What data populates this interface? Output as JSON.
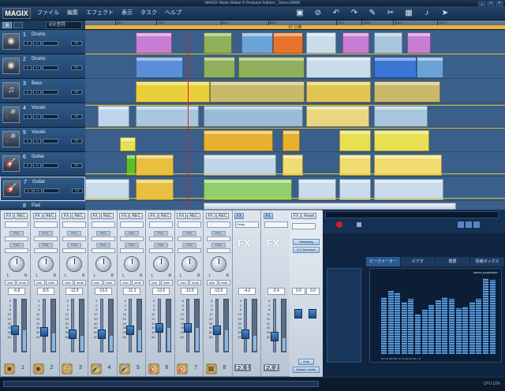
{
  "window": {
    "title": "MAGIX Music Maker 5 Producer Edition    _Demo.MMM"
  },
  "logo": "MAGIX",
  "menu": [
    "ファイル",
    "編集",
    "エフェクト",
    "表示",
    "タスク",
    "ヘルプ"
  ],
  "toolbar_icons": [
    "save-icon",
    "fx-icon",
    "undo-icon",
    "redo-icon",
    "draw-icon",
    "scissors-icon",
    "glue-icon",
    "note-icon",
    "pointer-icon"
  ],
  "snap": "8分音符",
  "range_label": "97 小節",
  "ruler_ticks": [
    "65:1",
    "73:1",
    "81:1",
    "89:1",
    "97:1",
    "105:1",
    "113:1",
    "121:1"
  ],
  "tracks": [
    {
      "num": "1",
      "name": "Drums",
      "icon": "drum-icon",
      "color": "#c45fbf"
    },
    {
      "num": "2",
      "name": "Drums",
      "icon": "drum-icon",
      "color": "#3d77d6"
    },
    {
      "num": "3",
      "name": "Bass",
      "icon": "bass-icon",
      "color": "#d8c338"
    },
    {
      "num": "4",
      "name": "Vocals",
      "icon": "vocals-icon",
      "color": "#a9c6df"
    },
    {
      "num": "5",
      "name": "Vocals",
      "icon": "vocals-icon",
      "color": "#e8e050"
    },
    {
      "num": "6",
      "name": "Guitar",
      "icon": "guitar-icon",
      "color": "#e8c040"
    },
    {
      "num": "7",
      "name": "Guitar",
      "icon": "guitar-icon",
      "color": "#b8d8ee"
    },
    {
      "num": "8",
      "name": "Pad",
      "icon": "pad-icon",
      "color": "#c8d8e8"
    }
  ],
  "mixer": {
    "strips": [
      {
        "fx": "FX",
        "rec": "REC",
        "fx1": "FX1",
        "fx2": "FX2",
        "solo": "solo",
        "mute": "mute",
        "volume": "-6.8",
        "num": "1",
        "level": 0.4
      },
      {
        "fx": "FX",
        "rec": "REC",
        "fx1": "FX1",
        "fx2": "FX2",
        "solo": "solo",
        "mute": "mute",
        "volume": "-8.5",
        "num": "2",
        "level": 0.35
      },
      {
        "fx": "FX",
        "rec": "REC",
        "fx1": "FX1",
        "fx2": "FX2",
        "solo": "solo",
        "mute": "mute",
        "volume": "-12.9",
        "num": "3",
        "level": 0.3
      },
      {
        "fx": "FX",
        "rec": "REC",
        "fx1": "FX1",
        "fx2": "FX2",
        "solo": "solo",
        "mute": "mute",
        "volume": "-13.6",
        "num": "4",
        "level": 0.3
      },
      {
        "fx": "FX",
        "rec": "REC",
        "fx1": "FX1",
        "fx2": "FX2",
        "solo": "solo",
        "mute": "mute",
        "volume": "-11.1",
        "num": "5",
        "level": 0.4
      },
      {
        "fx": "FX",
        "rec": "REC",
        "fx1": "FX1",
        "fx2": "FX2",
        "solo": "solo",
        "mute": "mute",
        "volume": "-13.6",
        "num": "6",
        "level": 0.45
      },
      {
        "fx": "FX",
        "rec": "REC",
        "fx1": "FX1",
        "fx2": "FX2",
        "solo": "solo",
        "mute": "mute",
        "volume": "-13.9",
        "num": "7",
        "level": 0.45
      },
      {
        "fx": "FX",
        "rec": "REC",
        "fx1": "FX1",
        "fx2": "FX2",
        "solo": "solo",
        "mute": "mute",
        "volume": "-13.9",
        "num": "8",
        "level": 0.4
      }
    ],
    "fx_returns": [
      {
        "label": "FX",
        "dd": "Delay",
        "volume": "-4.2",
        "num": "1",
        "level": 0.3
      },
      {
        "label": "FX",
        "dd": "",
        "volume": "-2.4",
        "num": "2",
        "level": 0.25
      }
    ],
    "master": {
      "fx": "FX",
      "reset": "Reset",
      "mastering": "Mastering",
      "surround": "5.1 Surround",
      "left": "0.0",
      "right": "0.0",
      "link": "Link",
      "limiter": "Master Limiter"
    },
    "scale": [
      "6",
      "0",
      "6",
      "10",
      "20",
      "30",
      "40",
      "50",
      "60"
    ]
  },
  "tabs": [
    "ピークメーター",
    "ビデオ",
    "概要",
    "情報ボックス"
  ],
  "peakmeter": {
    "title": "stereo peakmeter",
    "freqs": "60 120 250 500 1K 2K 4K 8K 16K L R",
    "levels": [
      0.72,
      0.8,
      0.78,
      0.66,
      0.7,
      0.5,
      0.56,
      0.62,
      0.68,
      0.72,
      0.7,
      0.58,
      0.6,
      0.66,
      0.7,
      0.96,
      0.94
    ]
  },
  "status": {
    "cpu": "CPU  11%"
  }
}
